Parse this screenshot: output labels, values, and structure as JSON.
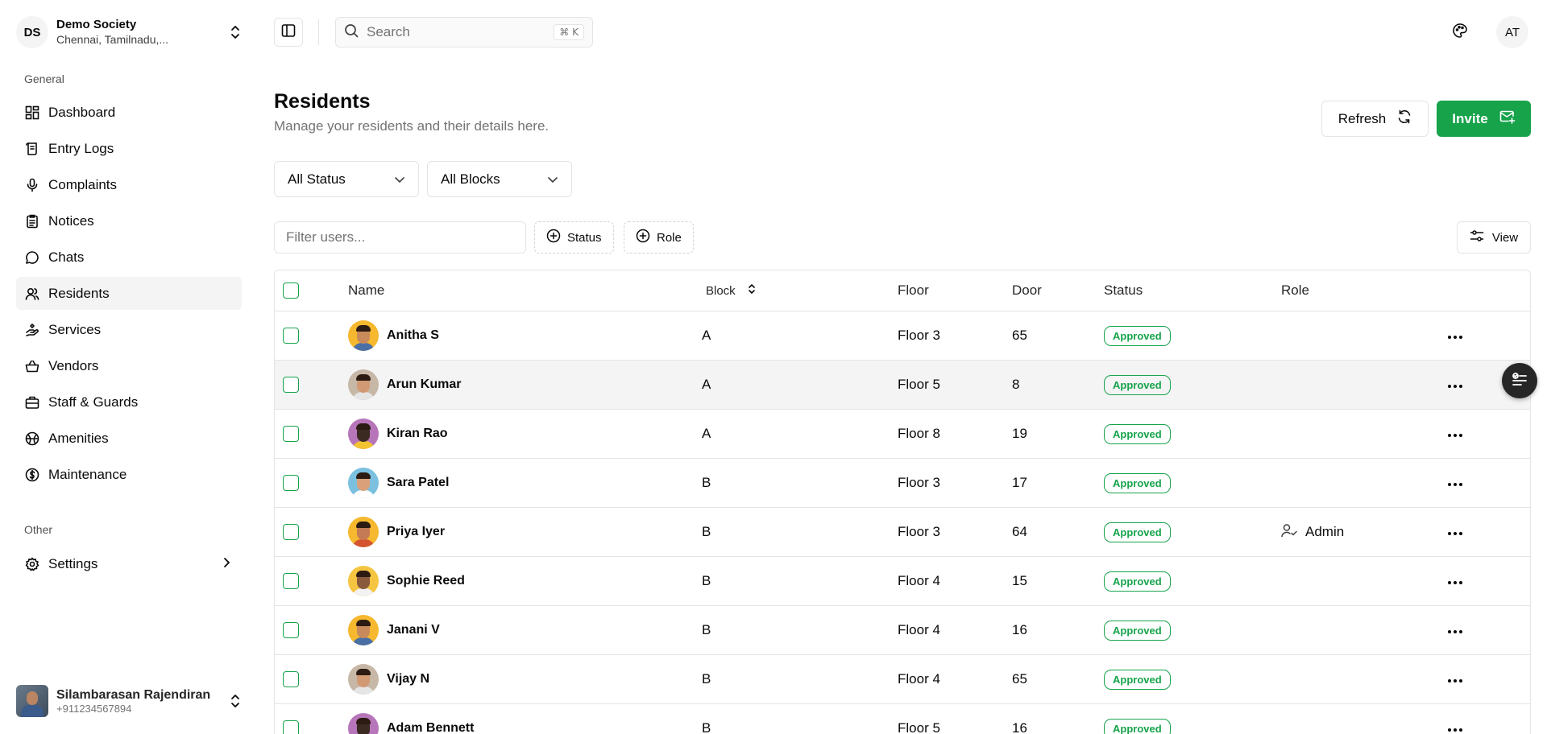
{
  "org": {
    "initials": "DS",
    "name": "Demo Society",
    "location": "Chennai, Tamilnadu,..."
  },
  "sidebar": {
    "general_label": "General",
    "items": [
      {
        "label": "Dashboard",
        "icon": "dashboard-icon"
      },
      {
        "label": "Entry Logs",
        "icon": "scroll-icon"
      },
      {
        "label": "Complaints",
        "icon": "mic-icon"
      },
      {
        "label": "Notices",
        "icon": "clipboard-icon"
      },
      {
        "label": "Chats",
        "icon": "chat-icon"
      },
      {
        "label": "Residents",
        "icon": "users-icon",
        "active": true
      },
      {
        "label": "Services",
        "icon": "hand-icon"
      },
      {
        "label": "Vendors",
        "icon": "basket-icon"
      },
      {
        "label": "Staff & Guards",
        "icon": "briefcase-icon"
      },
      {
        "label": "Amenities",
        "icon": "ball-icon"
      },
      {
        "label": "Maintenance",
        "icon": "dollar-icon"
      }
    ],
    "other_label": "Other",
    "settings_label": "Settings"
  },
  "user": {
    "name": "Silambarasan Rajendiran",
    "phone": "+911234567894"
  },
  "topbar": {
    "search_placeholder": "Search",
    "shortcut_symbol": "⌘",
    "shortcut_key": "K",
    "avatar_initials": "AT"
  },
  "header": {
    "title": "Residents",
    "subtitle": "Manage your residents and their details here.",
    "refresh_label": "Refresh",
    "invite_label": "Invite"
  },
  "filters": {
    "status_select": "All Status",
    "blocks_select": "All Blocks",
    "filter_placeholder": "Filter users...",
    "status_chip": "Status",
    "role_chip": "Role",
    "view_label": "View"
  },
  "table": {
    "columns": {
      "name": "Name",
      "block": "Block",
      "floor": "Floor",
      "door": "Door",
      "status": "Status",
      "role": "Role"
    },
    "rows": [
      {
        "name": "Anitha S",
        "block": "A",
        "floor": "Floor 3",
        "door": "65",
        "status": "Approved",
        "role": "",
        "bg": "#f5b82e",
        "skin": "#c98a5b",
        "shirt": "#4a6fa5"
      },
      {
        "name": "Arun Kumar",
        "block": "A",
        "floor": "Floor 5",
        "door": "8",
        "status": "Approved",
        "role": "",
        "bg": "#c7b7a6",
        "skin": "#d19a74",
        "shirt": "#e5e5e5"
      },
      {
        "name": "Kiran Rao",
        "block": "A",
        "floor": "Floor 8",
        "door": "19",
        "status": "Approved",
        "role": "",
        "bg": "#b776b9",
        "skin": "#3a2a22",
        "shirt": "#f2c230"
      },
      {
        "name": "Sara Patel",
        "block": "B",
        "floor": "Floor 3",
        "door": "17",
        "status": "Approved",
        "role": "",
        "bg": "#7cc0e0",
        "skin": "#d9a07a",
        "shirt": "#ffffff"
      },
      {
        "name": "Priya Iyer",
        "block": "B",
        "floor": "Floor 3",
        "door": "64",
        "status": "Approved",
        "role": "Admin",
        "bg": "#f5b82e",
        "skin": "#c47a55",
        "shirt": "#d3542f"
      },
      {
        "name": "Sophie Reed",
        "block": "B",
        "floor": "Floor 4",
        "door": "15",
        "status": "Approved",
        "role": "",
        "bg": "#f5c542",
        "skin": "#8a5a3c",
        "shirt": "#f2f2f2"
      },
      {
        "name": "Janani V",
        "block": "B",
        "floor": "Floor 4",
        "door": "16",
        "status": "Approved",
        "role": "",
        "bg": "#f5b82e",
        "skin": "#c98a5b",
        "shirt": "#4a6fa5"
      },
      {
        "name": "Vijay N",
        "block": "B",
        "floor": "Floor 4",
        "door": "65",
        "status": "Approved",
        "role": "",
        "bg": "#c7b7a6",
        "skin": "#d19a74",
        "shirt": "#e5e5e5"
      },
      {
        "name": "Adam Bennett",
        "block": "B",
        "floor": "Floor 5",
        "door": "16",
        "status": "Approved",
        "role": "",
        "bg": "#b776b9",
        "skin": "#3a2a22",
        "shirt": "#f2c230"
      }
    ]
  },
  "colors": {
    "accent": "#16a34a",
    "muted": "#737373",
    "border": "#e4e4e7"
  }
}
